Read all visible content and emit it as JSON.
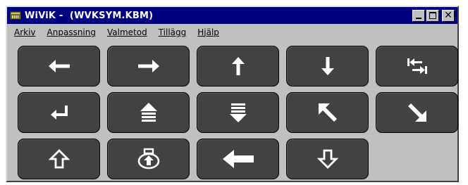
{
  "window": {
    "title": "WiViK -  (WVKSYM.KBM)",
    "title_buttons": {
      "close_glyph": "✕"
    }
  },
  "menu": {
    "items": [
      {
        "label": "Arkiv"
      },
      {
        "label": "Anpassning"
      },
      {
        "label": "Valmetod"
      },
      {
        "label": "Tillägg"
      },
      {
        "label": "Hjälp"
      }
    ]
  },
  "keys": {
    "row1": [
      {
        "icon": "arrow-left-icon"
      },
      {
        "icon": "arrow-right-icon"
      },
      {
        "icon": "arrow-up-icon"
      },
      {
        "icon": "arrow-down-icon"
      },
      {
        "icon": "tab-icon"
      }
    ],
    "row2": [
      {
        "icon": "enter-icon"
      },
      {
        "icon": "page-up-icon"
      },
      {
        "icon": "page-down-icon"
      },
      {
        "icon": "home-icon"
      },
      {
        "icon": "end-icon"
      }
    ],
    "row3": [
      {
        "icon": "shift-icon"
      },
      {
        "icon": "caps-lock-icon"
      },
      {
        "icon": "backspace-icon"
      },
      {
        "icon": "shift-down-icon"
      }
    ]
  },
  "colors": {
    "titlebar": "#000080",
    "window": "#c0c0c0",
    "key_face": "#424242",
    "glyph": "#ffffff"
  }
}
